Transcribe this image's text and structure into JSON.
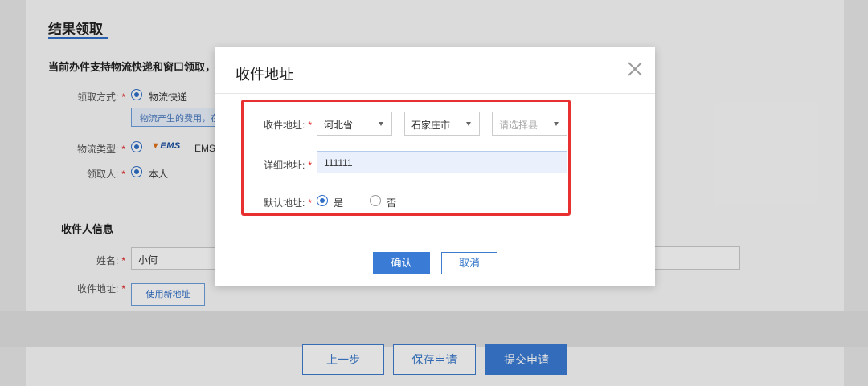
{
  "page": {
    "section_title": "结果领取",
    "notice": "当前办件支持物流快递和窗口领取，请",
    "pickup_method": {
      "label": "领取方式:",
      "option": "物流快递"
    },
    "tip": "物流产生的费用，在",
    "logistics_type": {
      "label": "物流类型:",
      "logo_text": "EMS",
      "name": "EMS特"
    },
    "receiver": {
      "label": "领取人:",
      "option": "本人"
    },
    "recipient_info_title": "收件人信息",
    "name": {
      "label": "姓名:",
      "value": "小何"
    },
    "address": {
      "label": "收件地址:",
      "new_address_button": "使用新地址"
    },
    "footer": {
      "prev": "上一步",
      "save": "保存申请",
      "submit": "提交申请"
    }
  },
  "modal": {
    "title": "收件地址",
    "address": {
      "label": "收件地址:",
      "province": "河北省",
      "city": "石家庄市",
      "county_placeholder": "请选择县"
    },
    "detail": {
      "label": "详细地址:",
      "value": "111111"
    },
    "default": {
      "label": "默认地址:",
      "yes": "是",
      "no": "否",
      "selected": "是"
    },
    "confirm": "确认",
    "cancel": "取消"
  },
  "colors": {
    "accent": "#3a7bd5",
    "required": "#e02020",
    "highlight": "#e83030"
  },
  "icons": {
    "close": "close-icon",
    "dropdown": "chevron-down-icon"
  }
}
